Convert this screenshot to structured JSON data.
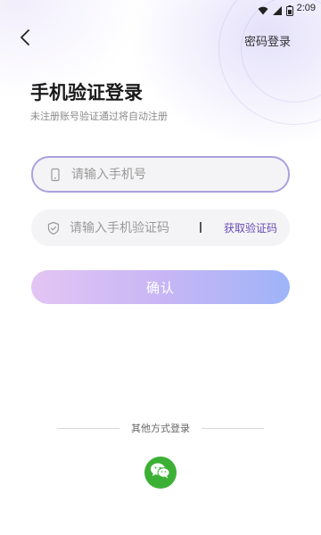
{
  "status_bar": {
    "time": "2:09",
    "icons": [
      "wifi-icon",
      "signal-icon",
      "battery-icon"
    ]
  },
  "header": {
    "back_icon": "chevron-left-icon",
    "switch_label": "密码登录"
  },
  "title": "手机验证登录",
  "subtitle": "未注册账号验证通过将自动注册",
  "phone_field": {
    "icon": "phone-icon",
    "placeholder": "请输入手机号",
    "value": ""
  },
  "code_field": {
    "icon": "shield-icon",
    "placeholder": "请输入手机验证码",
    "value": "",
    "get_code_label": "获取验证码"
  },
  "confirm_label": "确认",
  "other_login": {
    "label": "其他方式登录",
    "wechat_icon": "wechat-icon"
  },
  "colors": {
    "accent": "#6a4bb4",
    "field_border_focus": "#ad9fe0",
    "button_gradient_start": "#e3c5f4",
    "button_gradient_end": "#9fb4f8",
    "wechat_green": "#3cb034"
  }
}
